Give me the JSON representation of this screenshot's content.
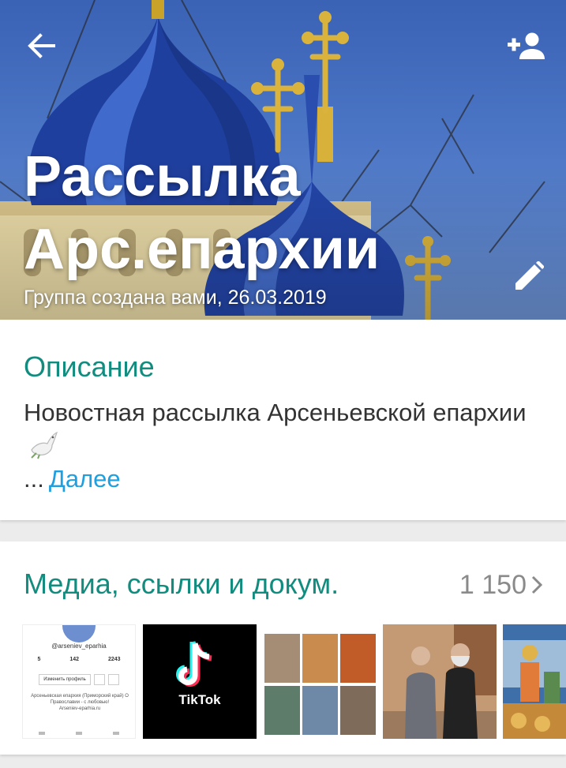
{
  "header": {
    "title_line1": "Рассылка",
    "title_line2": "Арс.епархии",
    "subtitle": "Группа создана вами, 26.03.2019",
    "back_icon": "arrow-back-icon",
    "add_participant_icon": "person-add-icon",
    "edit_icon": "pencil-icon"
  },
  "description": {
    "title": "Описание",
    "text": "Новостная рассылка Арсеньевской епархии",
    "emoji_icon": "dove-icon",
    "ellipsis": "...",
    "more_label": "Далее"
  },
  "media": {
    "title": "Медиа, ссылки и докум.",
    "count": "1 150",
    "chevron_icon": "chevron-right-icon",
    "thumbnails": {
      "profile": {
        "handle": "@arseniev_eparhia",
        "stat1": "5",
        "stat2": "142",
        "stat3": "2243",
        "edit_label": "Изменить профиль",
        "bio": "Арсеньевская епархия (Приморский край) О Православии - с любовью!",
        "link": "Arseniev-eparhia.ru"
      },
      "tiktok": {
        "label": "TikTok"
      }
    }
  },
  "colors": {
    "accent": "#128c7e",
    "link": "#1e9fe0",
    "header_sky": "#4a74c4"
  }
}
